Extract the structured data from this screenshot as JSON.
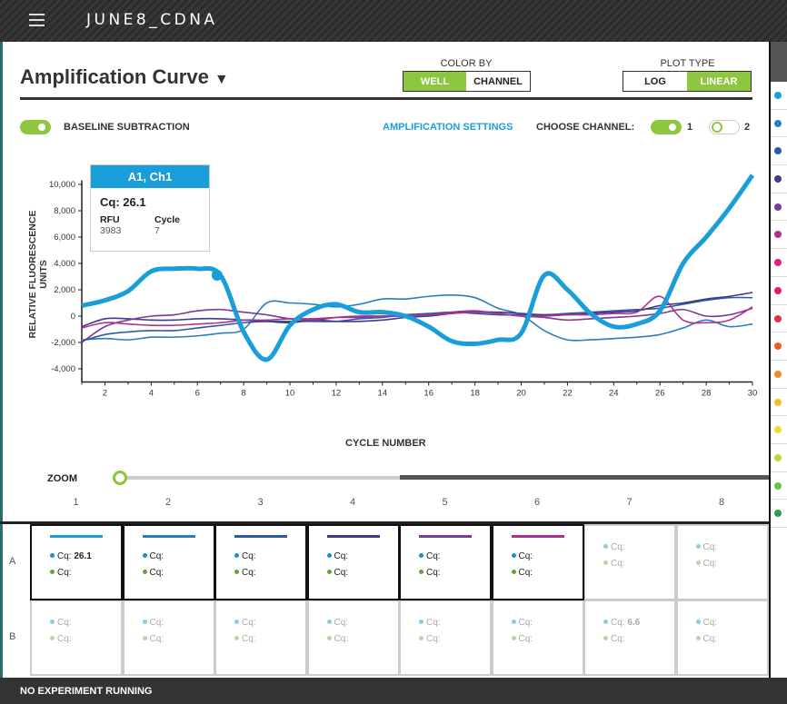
{
  "app": {
    "title": "JUNE8_CDNA",
    "menu_icon": "hamburger-icon"
  },
  "header": {
    "title": "Amplification Curve",
    "dropdown_icon": "triangle-down-icon"
  },
  "color_by": {
    "label": "COLOR BY",
    "options": [
      "WELL",
      "CHANNEL"
    ],
    "selected": "WELL"
  },
  "plot_type": {
    "label": "PLOT TYPE",
    "options": [
      "LOG",
      "LINEAR"
    ],
    "selected": "LINEAR"
  },
  "controls": {
    "baseline_label": "BASELINE SUBTRACTION",
    "baseline_on": true,
    "amp_settings": "AMPLIFICATION SETTINGS",
    "choose_channel": "CHOOSE CHANNEL:",
    "channels": [
      {
        "label": "1",
        "on": true
      },
      {
        "label": "2",
        "on": false
      }
    ]
  },
  "tooltip": {
    "title": "A1, Ch1",
    "cq": "Cq: 26.1",
    "rfu_label": "RFU",
    "rfu": "3983",
    "cycle_label": "Cycle",
    "cycle": "7"
  },
  "zoom": {
    "label": "ZOOM"
  },
  "colors": {
    "accent": "#8dc63f",
    "link": "#1a9ed9"
  },
  "chart_data": {
    "type": "line",
    "xlabel": "CYCLE NUMBER",
    "ylabel": "RELATIVE FLUORESCENCE UNITS",
    "xlim": [
      1,
      30
    ],
    "ylim": [
      -5000,
      11000
    ],
    "xticks": [
      "2",
      "4",
      "6",
      "8",
      "10",
      "12",
      "14",
      "16",
      "18",
      "20",
      "22",
      "24",
      "26",
      "28",
      "30"
    ],
    "yticks": [
      "10,000",
      "8,000",
      "6,000",
      "4,000",
      "2,000",
      "0",
      "-2,000",
      "-4,000"
    ],
    "x": [
      1,
      2,
      3,
      4,
      5,
      6,
      7,
      8,
      9,
      10,
      11,
      12,
      13,
      14,
      15,
      16,
      17,
      18,
      19,
      20,
      21,
      22,
      23,
      24,
      25,
      26,
      27,
      28,
      29,
      30
    ],
    "series": [
      {
        "well": "A1",
        "color": "#1a9ed9",
        "highlight": true,
        "values": [
          800,
          1200,
          1900,
          3400,
          3600,
          3600,
          3100,
          -1200,
          -3300,
          -700,
          500,
          900,
          300,
          300,
          0,
          -800,
          -1900,
          -2100,
          -1800,
          -1300,
          3100,
          2000,
          200,
          -800,
          -600,
          400,
          4000,
          6000,
          8200,
          10700
        ]
      },
      {
        "well": "A2",
        "color": "#2a7fc0",
        "values": [
          -1800,
          -1700,
          -1800,
          -1600,
          -1600,
          -1500,
          -1300,
          -1000,
          1000,
          1000,
          900,
          700,
          900,
          1300,
          1300,
          1500,
          1600,
          1400,
          600,
          100,
          -1100,
          -1800,
          -1800,
          -1700,
          -1600,
          -1400,
          -900,
          -300,
          -800,
          -600
        ]
      },
      {
        "well": "A3",
        "color": "#2c5aa0",
        "values": [
          -1900,
          -1400,
          -1200,
          -1100,
          -1100,
          -900,
          -700,
          -500,
          -400,
          -400,
          -400,
          -400,
          -200,
          -100,
          100,
          200,
          300,
          200,
          100,
          100,
          100,
          200,
          300,
          400,
          500,
          600,
          900,
          1200,
          1400,
          1400
        ]
      },
      {
        "well": "A4",
        "color": "#3f3a8c",
        "values": [
          -800,
          -200,
          -200,
          -300,
          -300,
          -200,
          -200,
          -300,
          -400,
          -500,
          -300,
          -400,
          -400,
          -300,
          -100,
          0,
          200,
          300,
          300,
          200,
          100,
          100,
          200,
          300,
          400,
          800,
          1000,
          1300,
          1500,
          1800
        ]
      },
      {
        "well": "A5",
        "color": "#7a3a9a",
        "values": [
          -2000,
          -800,
          -300,
          0,
          100,
          400,
          500,
          300,
          100,
          -200,
          -300,
          -100,
          0,
          0,
          0,
          100,
          300,
          400,
          200,
          0,
          -100,
          -300,
          -200,
          -100,
          0,
          200,
          500,
          0,
          100,
          600
        ]
      },
      {
        "well": "A6",
        "color": "#b0308f",
        "values": [
          -900,
          -500,
          -600,
          -700,
          -700,
          -600,
          -500,
          -300,
          -300,
          -200,
          -200,
          -100,
          -100,
          0,
          0,
          100,
          200,
          300,
          200,
          0,
          0,
          100,
          100,
          200,
          300,
          1500,
          -300,
          -500,
          -300,
          700
        ]
      }
    ],
    "marker": {
      "x": 6.85,
      "y": 3100
    }
  },
  "plate": {
    "columns": [
      "1",
      "2",
      "3",
      "4",
      "5",
      "6",
      "7",
      "8"
    ],
    "rows": [
      {
        "label": "A",
        "cells": [
          {
            "ch1": "Cq:",
            "ch1_val": "26.1",
            "ch2": "Cq:",
            "active": true,
            "color": "#1a9ed9"
          },
          {
            "ch1": "Cq:",
            "ch2": "Cq:",
            "active": true,
            "color": "#2a7fc0"
          },
          {
            "ch1": "Cq:",
            "ch2": "Cq:",
            "active": true,
            "color": "#2c5aa0"
          },
          {
            "ch1": "Cq:",
            "ch2": "Cq:",
            "active": true,
            "color": "#3f3a8c"
          },
          {
            "ch1": "Cq:",
            "ch2": "Cq:",
            "active": true,
            "color": "#7a3a9a"
          },
          {
            "ch1": "Cq:",
            "ch2": "Cq:",
            "active": true,
            "color": "#b0308f"
          },
          {
            "ch1": "Cq:",
            "ch2": "Cq:",
            "active": false
          },
          {
            "ch1": "Cq:",
            "ch2": "Cq:",
            "active": false
          }
        ]
      },
      {
        "label": "B",
        "cells": [
          {
            "ch1": "Cq:",
            "ch2": "Cq:",
            "active": false
          },
          {
            "ch1": "Cq:",
            "ch2": "Cq:",
            "active": false
          },
          {
            "ch1": "Cq:",
            "ch2": "Cq:",
            "active": false
          },
          {
            "ch1": "Cq:",
            "ch2": "Cq:",
            "active": false
          },
          {
            "ch1": "Cq:",
            "ch2": "Cq:",
            "active": false
          },
          {
            "ch1": "Cq:",
            "ch2": "Cq:",
            "active": false
          },
          {
            "ch1": "Cq:",
            "ch1_val": "6.6",
            "ch2": "Cq:",
            "active": false
          },
          {
            "ch1": "Cq:",
            "ch2": "Cq:",
            "active": false
          }
        ]
      }
    ]
  },
  "side_panel": {
    "dot_colors": [
      "#1a9ed9",
      "#2a7fc0",
      "#2c5aa0",
      "#3f3a8c",
      "#7a3a9a",
      "#b0308f",
      "#e0207f",
      "#e0205a",
      "#e0304a",
      "#f05a28",
      "#f08a28",
      "#f5b82e",
      "#f0dc30",
      "#b8d83a",
      "#6cbf4a",
      "#2e9e4e"
    ]
  },
  "footer": {
    "status": "NO EXPERIMENT RUNNING"
  }
}
